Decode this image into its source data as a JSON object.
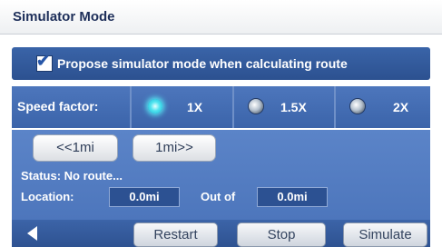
{
  "window": {
    "title": "Simulator Mode"
  },
  "propose_option": {
    "checked": true,
    "label": "Propose simulator mode when calculating route"
  },
  "speed": {
    "label": "Speed factor:",
    "options": [
      {
        "label": "1X",
        "selected": true
      },
      {
        "label": "1.5X",
        "selected": false
      },
      {
        "label": "2X",
        "selected": false
      }
    ]
  },
  "nav": {
    "back_label": "<<1mi",
    "forward_label": "1mi>>"
  },
  "status": {
    "text": "Status: No route..."
  },
  "location": {
    "label": "Location:",
    "value": "0.0mi",
    "out_of_label": "Out of",
    "total": "0.0mi"
  },
  "bottom": {
    "restart_label": "Restart",
    "stop_label": "Stop",
    "simulate_label": "Simulate"
  },
  "colors": {
    "panel_blue": "#4d76bc",
    "selected_radio": "#4fe3ef",
    "title_text": "#1e2f5a"
  }
}
